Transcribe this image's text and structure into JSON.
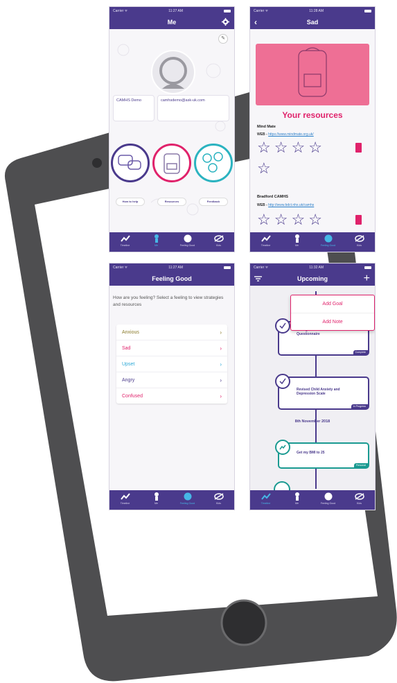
{
  "screens": {
    "me": {
      "status": {
        "carrier": "Carrier ᯤ",
        "time": "11:27 AM"
      },
      "title": "Me",
      "info_left": "CAMHS Demo",
      "info_right": "camhsdemo@ask-uk.com",
      "buttons": [
        "How to help",
        "Resources",
        "Feedback"
      ]
    },
    "sad": {
      "status": {
        "carrier": "Carrier ᯤ",
        "time": "11:28 AM"
      },
      "title": "Sad",
      "heading": "Your resources",
      "resources": [
        {
          "name": "Mind Mate",
          "web_prefix": "WEB - ",
          "url": "https://www.mindmate.org.uk/"
        },
        {
          "name": "Bradford CAMHS",
          "web_prefix": "WEB - ",
          "url": "http://www.bdct.nhs.uk/camhs"
        }
      ]
    },
    "feeling": {
      "status": {
        "carrier": "Carrier ᯤ",
        "time": "11:27 AM"
      },
      "title": "Feeling Good",
      "prompt": "How are you feeling? Select a feeling to view strategies and resources",
      "feelings": [
        {
          "label": "Anxious",
          "color": "#8a7a2a"
        },
        {
          "label": "Sad",
          "color": "#e0226b"
        },
        {
          "label": "Upset",
          "color": "#2aa7d6"
        },
        {
          "label": "Angry",
          "color": "#4a3a8c"
        },
        {
          "label": "Confused",
          "color": "#e0226b"
        }
      ]
    },
    "upcoming": {
      "status": {
        "carrier": "Carrier ᯤ",
        "time": "11:32 AM"
      },
      "title": "Upcoming",
      "menu": [
        "Add Goal",
        "Add Note"
      ],
      "date_label": "8th November 2018",
      "items": [
        {
          "text": "Strengths and Difficulties Questionnaire",
          "tag": "Complete",
          "color": "#4a3a8c"
        },
        {
          "text": "Revised Child Anxiety and Depression Scale",
          "tag": "In Progress",
          "color": "#4a3a8c"
        },
        {
          "text": "Get my BMI to 25",
          "tag": "Personal",
          "color": "#1a9a91"
        }
      ]
    }
  },
  "tabs": [
    "Timeline",
    "Me",
    "Feeling Good",
    "Kids"
  ],
  "colors": {
    "brand": "#4a3a8c",
    "pink": "#e0226b",
    "teal": "#2bb3c0",
    "blue": "#46b7e6",
    "device": "#5a5a5d"
  }
}
